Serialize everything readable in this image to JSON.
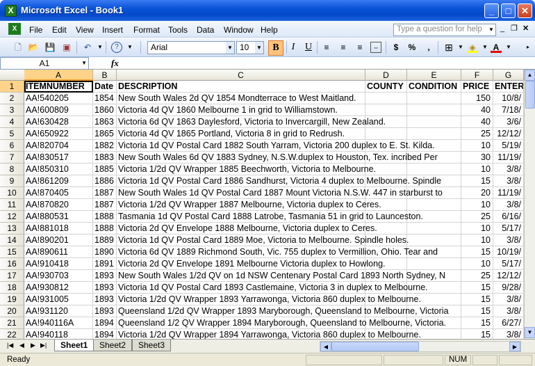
{
  "window": {
    "title": "Microsoft Excel - Book1",
    "app_icon": "X"
  },
  "menu": {
    "items": [
      "File",
      "Edit",
      "View",
      "Insert",
      "Format",
      "Tools",
      "Data",
      "Window",
      "Help"
    ],
    "help_placeholder": "Type a question for help"
  },
  "toolbar": {
    "font": "Arial",
    "size": "10"
  },
  "formula_bar": {
    "name_box": "A1",
    "fx": "fx"
  },
  "columns": [
    "A",
    "B",
    "C",
    "D",
    "E",
    "F",
    "G"
  ],
  "header_row": {
    "row": "1",
    "cells": [
      "ITEMNUMBER",
      "Date",
      "DESCRIPTION",
      "COUNTY",
      "CONDITION",
      "PRICE",
      "ENTER"
    ]
  },
  "rows": [
    {
      "row": "2",
      "item": "AA!540205",
      "date": "1854",
      "desc": "New South Wales 2d QV 1854 Mondterrace to West Maitland.",
      "price": "150",
      "enter": "10/8/"
    },
    {
      "row": "3",
      "item": "AA!600809",
      "date": "1860",
      "desc": "Victoria 4d QV 1860 Melbourne 1 in grid to Williamstown.",
      "price": "40",
      "enter": "7/18/"
    },
    {
      "row": "4",
      "item": "AA!630428",
      "date": "1863",
      "desc": "Victoria 6d QV 1863 Daylesford, Victoria to Invercargill, New Zealand.",
      "price": "40",
      "enter": "3/6/"
    },
    {
      "row": "5",
      "item": "AA!650922",
      "date": "1865",
      "desc": "Victoria 4d QV 1865 Portland, Victoria 8 in grid to Redrush.",
      "price": "25",
      "enter": "12/12/"
    },
    {
      "row": "6",
      "item": "AA!820704",
      "date": "1882",
      "desc": "Victoria 1d QV Postal Card 1882 South Yarram, Victoria 200 duplex to E. St. Kilda.",
      "price": "10",
      "enter": "5/19/"
    },
    {
      "row": "7",
      "item": "AA!830517",
      "date": "1883",
      "desc": "New South Wales 6d QV 1883 Sydney, N.S.W.duplex to Houston, Tex. incribed Per",
      "price": "30",
      "enter": "11/19/"
    },
    {
      "row": "8",
      "item": "AA!850310",
      "date": "1885",
      "desc": "Victoria 1/2d QV Wrapper 1885 Beechworth, Victoria to Melbourne.",
      "price": "10",
      "enter": "3/8/"
    },
    {
      "row": "9",
      "item": "AA!861209",
      "date": "1886",
      "desc": "Victoria 1d QV Postal Card 1886 Sandhurst, Victoria 4 duplex to Melbourne.  Spindle",
      "price": "15",
      "enter": "3/8/"
    },
    {
      "row": "10",
      "item": "AA!870405",
      "date": "1887",
      "desc": "New South Wales 1d QV Postal Card 1887 Mount Victoria N.S.W. 447 in starburst to",
      "price": "20",
      "enter": "11/19/"
    },
    {
      "row": "11",
      "item": "AA!870820",
      "date": "1887",
      "desc": "Victoria 1/2d QV Wrapper 1887 Melbourne, Victoria duplex to Ceres.",
      "price": "10",
      "enter": "3/8/"
    },
    {
      "row": "12",
      "item": "AA!880531",
      "date": "1888",
      "desc": "Tasmania 1d QV Postal Card 1888 Latrobe, Tasmania 51 in grid to Launceston.",
      "price": "25",
      "enter": "6/16/"
    },
    {
      "row": "13",
      "item": "AA!881018",
      "date": "1888",
      "desc": "Victoria 2d QV Envelope 1888 Melbourne, Victoria duplex to Ceres.",
      "price": "10",
      "enter": "5/17/"
    },
    {
      "row": "14",
      "item": "AA!890201",
      "date": "1889",
      "desc": "Victoria 1d QV Postal Card 1889 Moe, Victoria to Melbourne.  Spindle holes.",
      "price": "10",
      "enter": "3/8/"
    },
    {
      "row": "15",
      "item": "AA!890611",
      "date": "1890",
      "desc": "Victoria 6d QV 1889 Richmond South, Vic. 755 duplex to Vermillion, Ohio.  Tear and",
      "price": "15",
      "enter": "10/19/"
    },
    {
      "row": "16",
      "item": "AA!910418",
      "date": "1891",
      "desc": "Victoria 2d QV Envelope 1891 Melbourne Victoria duplex to Howlong.",
      "price": "10",
      "enter": "5/17/"
    },
    {
      "row": "17",
      "item": "AA!930703",
      "date": "1893",
      "desc": "New South Wales 1/2d QV on 1d NSW Centenary Postal Card 1893 North Sydney, N",
      "price": "25",
      "enter": "12/12/"
    },
    {
      "row": "18",
      "item": "AA!930812",
      "date": "1893",
      "desc": "Victoria 1d QV Postal Card 1893 Castlemaine, Victoria 3 in duplex to Melbourne.",
      "price": "15",
      "enter": "9/28/"
    },
    {
      "row": "19",
      "item": "AA!931005",
      "date": "1893",
      "desc": "Victoria 1/2d QV Wrapper 1893 Yarrawonga, Victoria 860 duplex to Melbourne.",
      "price": "15",
      "enter": "3/8/"
    },
    {
      "row": "20",
      "item": "AA!931120",
      "date": "1893",
      "desc": "Queensland 1/2d QV Wrapper 1893 Maryborough, Queensland to Melbourne, Victoria",
      "price": "15",
      "enter": "3/8/"
    },
    {
      "row": "21",
      "item": "AA!940116A",
      "date": "1894",
      "desc": "Queensland 1/2 QV Wrapper 1894 Maryborough, Queensland to Melbourne, Victoria.",
      "price": "15",
      "enter": "6/27/"
    },
    {
      "row": "22",
      "item": "AA!940118",
      "date": "1894",
      "desc": "Victoria 1/2d QV Wrapper 1894 Yarrawonga, Victoria 860 duplex to Melbourne.",
      "price": "15",
      "enter": "3/8/"
    }
  ],
  "sheets": [
    "Sheet1",
    "Sheet2",
    "Sheet3"
  ],
  "status": {
    "ready": "Ready",
    "num": "NUM"
  }
}
